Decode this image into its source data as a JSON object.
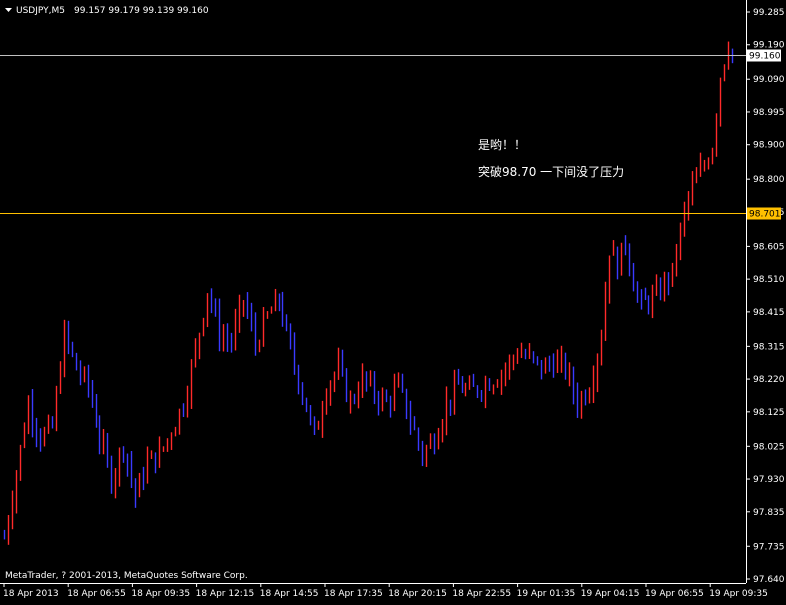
{
  "header": {
    "symbol": "USDJPY,M5",
    "ohlc": "99.157 99.179 99.139 99.160"
  },
  "annotation": {
    "line1": "是哟！！",
    "line2": "突破98.70 一下间没了压力"
  },
  "footer": {
    "copyright": "MetaTrader, ? 2001-2013, MetaQuotes Software Corp."
  },
  "colors": {
    "background": "#000000",
    "axis": "#ffffff",
    "bull": "#ff2a2a",
    "bear": "#3a3aff",
    "level_line": "#ffc000",
    "bid_line": "#c0c0c0",
    "text": "#ffffff"
  },
  "chart_data": {
    "type": "bar",
    "symbol": "USDJPY",
    "timeframe": "M5",
    "ylim": [
      97.64,
      99.285
    ],
    "y_ticks": [
      99.285,
      99.19,
      99.09,
      98.995,
      98.9,
      98.8,
      98.705,
      98.605,
      98.51,
      98.415,
      98.315,
      98.22,
      98.125,
      98.025,
      97.93,
      97.835,
      97.735,
      97.64
    ],
    "y_tick_labels": [
      "99.285",
      "99.190",
      "99.090",
      "98.995",
      "98.900",
      "98.800",
      "98.705",
      "98.605",
      "98.510",
      "98.415",
      "98.315",
      "98.220",
      "98.125",
      "98.025",
      "97.930",
      "97.835",
      "97.735",
      "97.640"
    ],
    "x_labels": [
      "18 Apr 2013",
      "18 Apr 06:55",
      "18 Apr 09:35",
      "18 Apr 12:15",
      "18 Apr 14:55",
      "18 Apr 17:35",
      "18 Apr 20:15",
      "18 Apr 22:55",
      "19 Apr 01:35",
      "19 Apr 04:15",
      "19 Apr 06:55",
      "19 Apr 09:35"
    ],
    "levels": [
      {
        "price": 98.701,
        "label": "98.701",
        "color": "#ffc000"
      }
    ],
    "current_price": {
      "price": 99.16,
      "label": "99.160"
    },
    "anchors": [
      [
        0,
        97.76
      ],
      [
        3,
        97.95
      ],
      [
        6,
        98.15
      ],
      [
        9,
        98.05
      ],
      [
        12,
        98.08
      ],
      [
        15,
        98.35
      ],
      [
        18,
        98.25
      ],
      [
        21,
        98.2
      ],
      [
        24,
        98.05
      ],
      [
        27,
        97.93
      ],
      [
        30,
        98.03
      ],
      [
        33,
        97.88
      ],
      [
        36,
        97.98
      ],
      [
        39,
        98.0
      ],
      [
        42,
        98.07
      ],
      [
        45,
        98.15
      ],
      [
        48,
        98.3
      ],
      [
        51,
        98.48
      ],
      [
        54,
        98.35
      ],
      [
        57,
        98.33
      ],
      [
        60,
        98.45
      ],
      [
        63,
        98.32
      ],
      [
        66,
        98.4
      ],
      [
        69,
        98.45
      ],
      [
        72,
        98.3
      ],
      [
        75,
        98.18
      ],
      [
        78,
        98.05
      ],
      [
        81,
        98.2
      ],
      [
        84,
        98.25
      ],
      [
        87,
        98.15
      ],
      [
        90,
        98.22
      ],
      [
        93,
        98.18
      ],
      [
        96,
        98.15
      ],
      [
        99,
        98.2
      ],
      [
        102,
        98.1
      ],
      [
        105,
        98.0
      ],
      [
        108,
        98.05
      ],
      [
        111,
        98.15
      ],
      [
        114,
        98.2
      ],
      [
        117,
        98.18
      ],
      [
        120,
        98.2
      ],
      [
        123,
        98.22
      ],
      [
        126,
        98.25
      ],
      [
        129,
        98.3
      ],
      [
        132,
        98.28
      ],
      [
        135,
        98.25
      ],
      [
        138,
        98.27
      ],
      [
        141,
        98.25
      ],
      [
        144,
        98.15
      ],
      [
        147,
        98.2
      ],
      [
        150,
        98.35
      ],
      [
        152,
        98.6
      ],
      [
        154,
        98.55
      ],
      [
        156,
        98.62
      ],
      [
        158,
        98.5
      ],
      [
        160,
        98.43
      ],
      [
        162,
        98.45
      ],
      [
        164,
        98.46
      ],
      [
        166,
        98.5
      ],
      [
        168,
        98.53
      ],
      [
        170,
        98.65
      ],
      [
        172,
        98.75
      ],
      [
        174,
        98.8
      ],
      [
        176,
        98.84
      ],
      [
        178,
        98.9
      ],
      [
        180,
        99.1
      ],
      [
        182,
        99.2
      ],
      [
        183,
        99.16
      ]
    ]
  }
}
